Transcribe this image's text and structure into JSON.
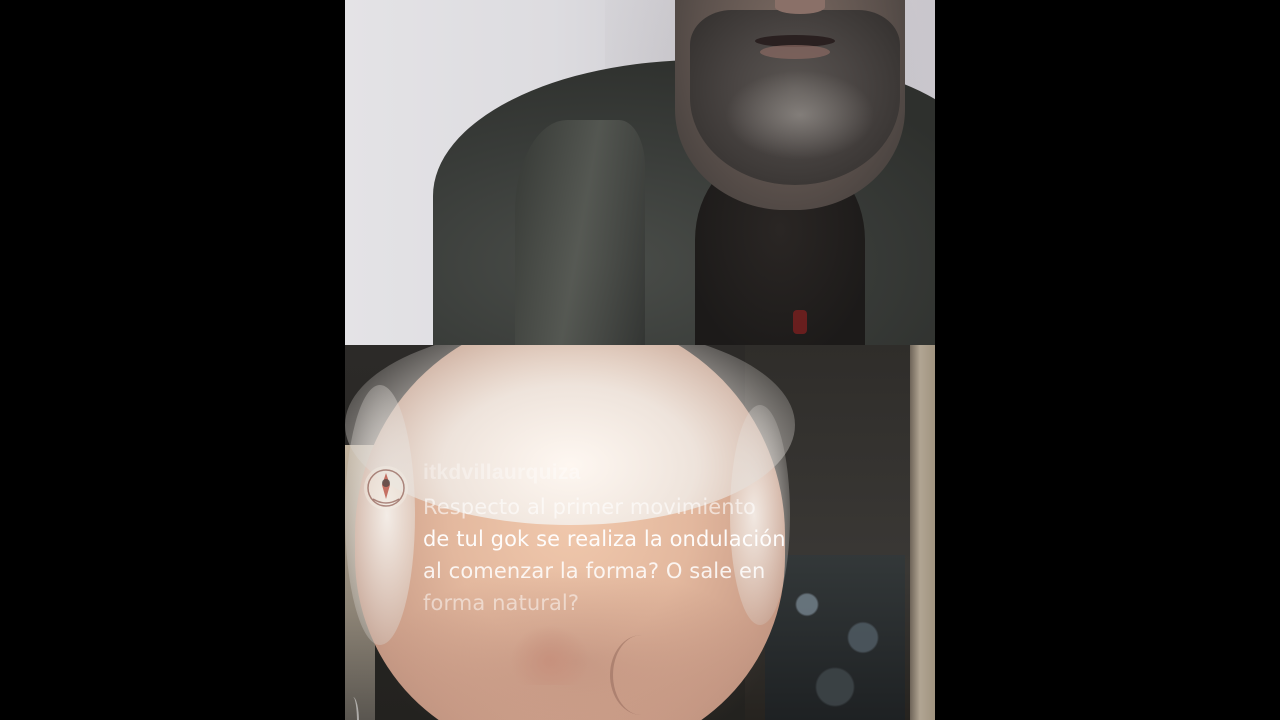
{
  "feeds": {
    "top": {
      "name": "top-video-feed"
    },
    "bottom": {
      "name": "bottom-video-feed"
    }
  },
  "comment": {
    "username": "itkdvillaurquiza",
    "lines": [
      "Respecto al primer movimiento",
      "de tul gok se realiza la ondulación",
      "al comenzar la forma? O sale en",
      "forma natural?"
    ]
  },
  "colors": {
    "page_background": "#000000",
    "comment_text": "#ffffff",
    "avatar_accent": "#b23a2a"
  }
}
